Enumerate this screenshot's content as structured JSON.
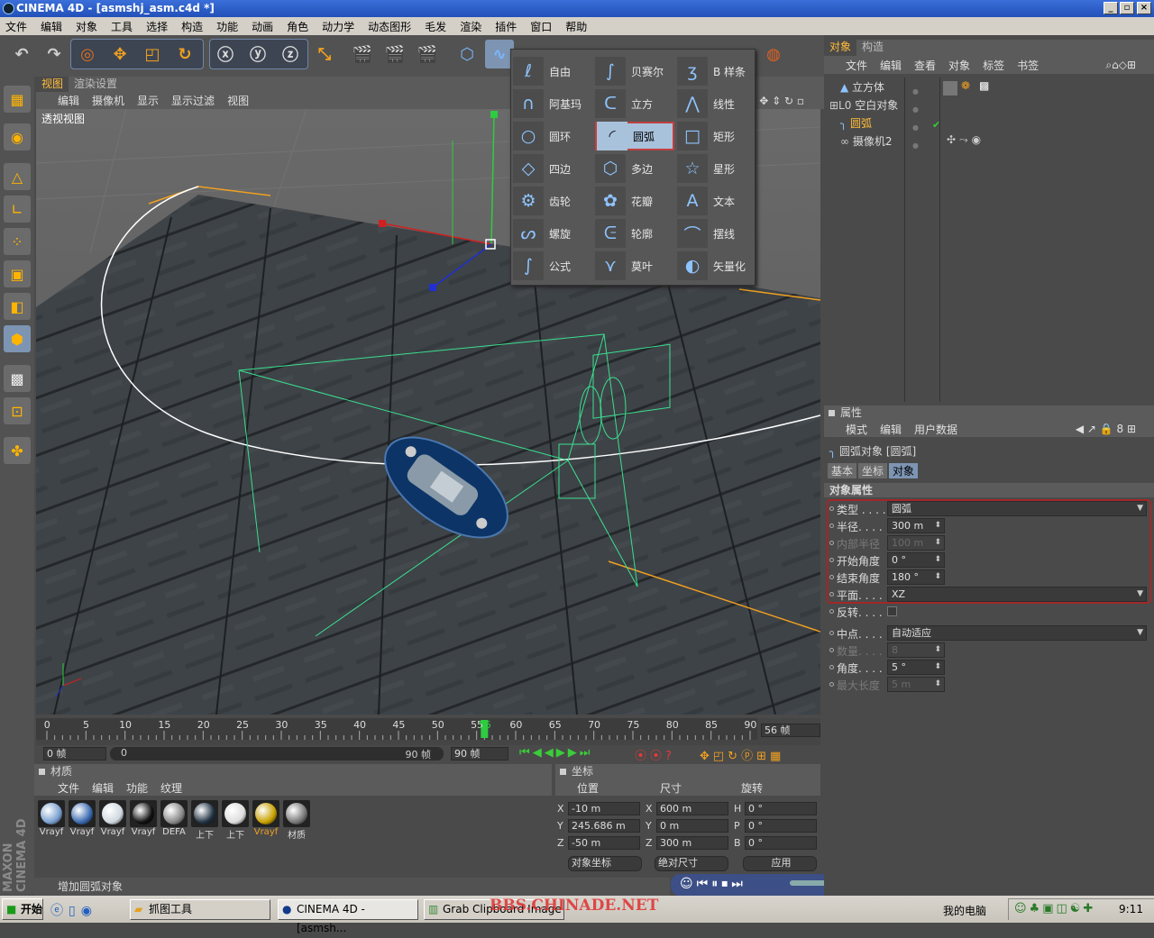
{
  "title": "CINEMA 4D - [asmshj_asm.c4d *]",
  "menu": [
    "文件",
    "编辑",
    "对象",
    "工具",
    "选择",
    "构造",
    "功能",
    "动画",
    "角色",
    "动力学",
    "动态图形",
    "毛发",
    "渲染",
    "插件",
    "窗口",
    "帮助"
  ],
  "viewport": {
    "tabs": [
      "视图",
      "渲染设置"
    ],
    "menu": [
      "编辑",
      "摄像机",
      "显示",
      "显示过滤",
      "视图"
    ],
    "label": "透视视图"
  },
  "spline_menu": {
    "items": [
      {
        "label": "自由",
        "icon": "freehand-spline-icon"
      },
      {
        "label": "贝赛尔",
        "icon": "bezier-spline-icon"
      },
      {
        "label": "B 样条",
        "icon": "b-spline-icon"
      },
      {
        "label": "阿基玛",
        "icon": "akima-spline-icon"
      },
      {
        "label": "立方",
        "icon": "cubic-spline-icon"
      },
      {
        "label": "线性",
        "icon": "linear-spline-icon"
      },
      {
        "label": "圆环",
        "icon": "circle-spline-icon"
      },
      {
        "label": "圆弧",
        "icon": "arc-spline-icon"
      },
      {
        "label": "矩形",
        "icon": "rectangle-spline-icon"
      },
      {
        "label": "四边",
        "icon": "4side-spline-icon"
      },
      {
        "label": "多边",
        "icon": "polygon-spline-icon"
      },
      {
        "label": "星形",
        "icon": "star-spline-icon"
      },
      {
        "label": "齿轮",
        "icon": "cogwheel-spline-icon"
      },
      {
        "label": "花瓣",
        "icon": "flower-spline-icon"
      },
      {
        "label": "文本",
        "icon": "text-spline-icon"
      },
      {
        "label": "螺旋",
        "icon": "helix-spline-icon"
      },
      {
        "label": "轮廓",
        "icon": "profile-spline-icon"
      },
      {
        "label": "摆线",
        "icon": "cycloid-spline-icon"
      },
      {
        "label": "公式",
        "icon": "formula-spline-icon"
      },
      {
        "label": "莫叶",
        "icon": "cissoid-spline-icon"
      },
      {
        "label": "矢量化",
        "icon": "vectorizer-icon"
      }
    ],
    "selected": "圆弧"
  },
  "timeline": {
    "ticks": [
      "0",
      "5",
      "10",
      "15",
      "20",
      "25",
      "30",
      "35",
      "40",
      "45",
      "50",
      "55",
      "56",
      "60",
      "65",
      "70",
      "75",
      "80",
      "85",
      "90"
    ],
    "current": "56 帧",
    "current_marker": 56,
    "start": "0 帧",
    "range_start": "0",
    "range_end": "90 帧",
    "end": "90 帧"
  },
  "materials": {
    "header": "材质",
    "menu": [
      "文件",
      "编辑",
      "功能",
      "纹理"
    ],
    "items": [
      "Vrayf",
      "Vrayf",
      "Vrayf",
      "Vrayf",
      "DEFA",
      "上下",
      "上下",
      "Vrayf",
      "材质"
    ]
  },
  "coords": {
    "header": "坐标",
    "cols": [
      "位置",
      "尺寸",
      "旋转"
    ],
    "rows": [
      {
        "axis": "X",
        "pos": "-10 m",
        "saxis": "X",
        "size": "600 m",
        "raxis": "H",
        "rot": "0 °"
      },
      {
        "axis": "Y",
        "pos": "245.686 m",
        "saxis": "Y",
        "size": "0 m",
        "raxis": "P",
        "rot": "0 °"
      },
      {
        "axis": "Z",
        "pos": "-50 m",
        "saxis": "Z",
        "size": "300 m",
        "raxis": "B",
        "rot": "0 °"
      }
    ],
    "mode": "对象坐标",
    "size_mode": "绝对尺寸",
    "apply": "应用"
  },
  "status": "增加圆弧对象",
  "objects": {
    "tabs": [
      "对象",
      "构造"
    ],
    "menu": [
      "文件",
      "编辑",
      "查看",
      "对象",
      "标签",
      "书签"
    ],
    "items": [
      "立方体",
      "空白对象",
      "圆弧",
      "摄像机2"
    ]
  },
  "attributes": {
    "header": "属性",
    "menu": [
      "模式",
      "编辑",
      "用户数据"
    ],
    "object": "圆弧对象 [圆弧]",
    "tabs": [
      "基本",
      "坐标",
      "对象"
    ],
    "section": "对象属性",
    "fields": [
      {
        "label": "类型 . . . .",
        "value": "圆弧",
        "kind": "select"
      },
      {
        "label": "半径. . . .",
        "value": "300 m",
        "kind": "num"
      },
      {
        "label": "内部半径",
        "value": "100 m",
        "kind": "num",
        "dim": true
      },
      {
        "label": "开始角度",
        "value": "0 °",
        "kind": "num"
      },
      {
        "label": "结束角度",
        "value": "180 °",
        "kind": "num"
      },
      {
        "label": "平面. . . .",
        "value": "XZ",
        "kind": "select"
      },
      {
        "label": "反转. . . .",
        "value": "",
        "kind": "check"
      },
      {
        "label": "中点. . . .",
        "value": "自动适应",
        "kind": "select"
      },
      {
        "label": "数量. . . .",
        "value": "8",
        "kind": "num",
        "dim": true
      },
      {
        "label": "角度. . . .",
        "value": "5 °",
        "kind": "num"
      },
      {
        "label": "最大长度",
        "value": "5 m",
        "kind": "num",
        "dim": true
      }
    ]
  },
  "taskbar": {
    "start": "开始",
    "tasks": [
      "抓图工具",
      "CINEMA 4D - [asmsh...",
      "Grab Clipboard Image"
    ],
    "tray_label": "我的电脑",
    "clock": "9:11"
  },
  "watermark": "BBS.CHINADE.NET",
  "maxon": "MAXON CINEMA 4D"
}
